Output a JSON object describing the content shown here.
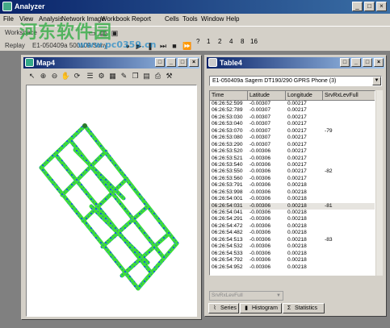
{
  "app": {
    "title": "Analyzer",
    "window_buttons": [
      "_",
      "□",
      "×"
    ]
  },
  "menu": [
    "File",
    "View",
    "Analysis",
    "Network Image",
    "Workbook",
    "Report",
    "Cells",
    "Tools",
    "Window",
    "Help"
  ],
  "toolbar": {
    "workspace_label": "Workspace",
    "replay_label": "Replay",
    "file_label": "E1-050409a 500109 Sony",
    "speed_buttons": [
      "?",
      "1",
      "2",
      "4",
      "8",
      "16"
    ]
  },
  "watermark": {
    "line1": "河东软件园",
    "line2": "www.pc0359.cn"
  },
  "map_window": {
    "title": "Map4",
    "buttons": [
      "□",
      "_",
      "□",
      "×"
    ]
  },
  "table_window": {
    "title": "Table4",
    "buttons": [
      "□",
      "_",
      "□",
      "×"
    ],
    "device": "E1-050409a Sagem DT190/290 GPRS Phone (3)",
    "columns": [
      "Time",
      "Latitude",
      "Longitude",
      "SrvRxLevFull"
    ],
    "rows": [
      [
        "06:26:52:599",
        "-0.00307",
        "0.00217",
        ""
      ],
      [
        "06:26:52:789",
        "-0.00307",
        "0.00217",
        ""
      ],
      [
        "06:26:53:030",
        "-0.00307",
        "0.00217",
        ""
      ],
      [
        "06:26:53:040",
        "-0.00307",
        "0.00217",
        ""
      ],
      [
        "06:26:53:070",
        "-0.00307",
        "0.00217",
        "-79"
      ],
      [
        "06:26:53:080",
        "-0.00307",
        "0.00217",
        ""
      ],
      [
        "06:26:53:290",
        "-0.00307",
        "0.00217",
        ""
      ],
      [
        "06:26:53:520",
        "-0.00306",
        "0.00217",
        ""
      ],
      [
        "06:26:53:521",
        "-0.00306",
        "0.00217",
        ""
      ],
      [
        "06:26:53:540",
        "-0.00306",
        "0.00217",
        ""
      ],
      [
        "06:26:53:550",
        "-0.00306",
        "0.00217",
        "-82"
      ],
      [
        "06:26:53:560",
        "-0.00306",
        "0.00217",
        ""
      ],
      [
        "06:26:53:791",
        "-0.00306",
        "0.00218",
        ""
      ],
      [
        "06:26:53:998",
        "-0.00306",
        "0.00218",
        ""
      ],
      [
        "06:26:54:001",
        "-0.00306",
        "0.00218",
        ""
      ],
      [
        "06:26:54:031",
        "-0.00306",
        "0.00218",
        "-81"
      ],
      [
        "06:26:54:041",
        "-0.00306",
        "0.00218",
        ""
      ],
      [
        "06:26:54:291",
        "-0.00306",
        "0.00218",
        ""
      ],
      [
        "06:26:54:472",
        "-0.00306",
        "0.00218",
        ""
      ],
      [
        "06:26:54:482",
        "-0.00306",
        "0.00218",
        ""
      ],
      [
        "06:26:54:513",
        "-0.00306",
        "0.00218",
        "-83"
      ],
      [
        "06:26:54:532",
        "-0.00306",
        "0.00218",
        ""
      ],
      [
        "06:26:54:533",
        "-0.00306",
        "0.00218",
        ""
      ],
      [
        "06:26:54:792",
        "-0.00306",
        "0.00218",
        ""
      ],
      [
        "06:26:54:952",
        "-0.00306",
        "0.00218",
        ""
      ]
    ],
    "selected_row": 15,
    "series_dropdown": "SrvRxLevFull",
    "tabs": [
      {
        "label": "Series",
        "icon": "series-icon"
      },
      {
        "label": "Histogram",
        "icon": "histogram-icon"
      },
      {
        "label": "Statistics",
        "icon": "sigma-icon"
      }
    ]
  },
  "colors": {
    "title_bar": "#0a246a",
    "route_green": "#3ddc3a",
    "route_blue": "#1a5fd6"
  }
}
